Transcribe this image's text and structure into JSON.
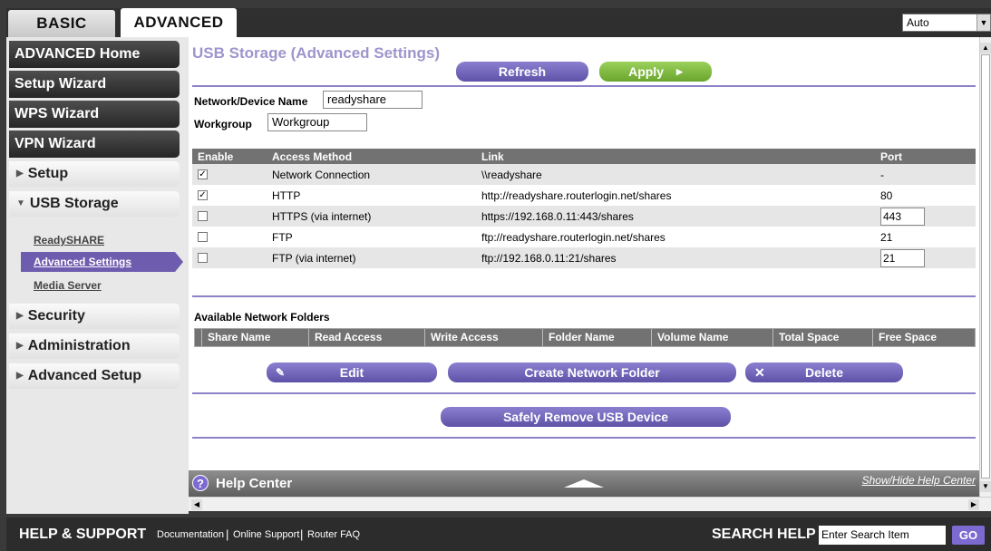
{
  "tabs": {
    "basic": "BASIC",
    "advanced": "ADVANCED"
  },
  "language": {
    "selected": "Auto"
  },
  "nav": {
    "advanced_home": "ADVANCED Home",
    "setup_wizard": "Setup Wizard",
    "wps_wizard": "WPS Wizard",
    "vpn_wizard": "VPN Wizard",
    "setup": "Setup",
    "usb_storage": "USB Storage",
    "usb_sub": {
      "readyshare": "ReadySHARE",
      "advanced_settings": "Advanced Settings",
      "media_server": "Media Server"
    },
    "security": "Security",
    "administration": "Administration",
    "advanced_setup": "Advanced Setup"
  },
  "page": {
    "title": "USB Storage (Advanced Settings)",
    "refresh": "Refresh",
    "apply": "Apply",
    "device_name_label": "Network/Device Name",
    "device_name_value": "readyshare",
    "workgroup_label": "Workgroup",
    "workgroup_value": "Workgroup"
  },
  "access_table": {
    "headers": {
      "enable": "Enable",
      "method": "Access Method",
      "link": "Link",
      "port": "Port"
    },
    "rows": [
      {
        "checked": true,
        "method": "Network Connection",
        "link": "\\\\readyshare",
        "port": "-",
        "port_editable": false
      },
      {
        "checked": true,
        "method": "HTTP",
        "link": "http://readyshare.routerlogin.net/shares",
        "port": "80",
        "port_editable": false
      },
      {
        "checked": false,
        "method": "HTTPS (via internet)",
        "link": "https://192.168.0.11:443/shares",
        "port": "443",
        "port_editable": true
      },
      {
        "checked": false,
        "method": "FTP",
        "link": "ftp://readyshare.routerlogin.net/shares",
        "port": "21",
        "port_editable": false
      },
      {
        "checked": false,
        "method": "FTP (via internet)",
        "link": "ftp://192.168.0.11:21/shares",
        "port": "21",
        "port_editable": true
      }
    ]
  },
  "folders": {
    "label": "Available Network Folders",
    "headers": [
      "Share Name",
      "Read Access",
      "Write Access",
      "Folder Name",
      "Volume Name",
      "Total Space",
      "Free Space"
    ],
    "edit": "Edit",
    "create": "Create Network Folder",
    "delete": "Delete",
    "safely_remove": "Safely Remove USB Device"
  },
  "help": {
    "title": "Help Center",
    "toggle": "Show/Hide Help Center",
    "icon": "?"
  },
  "footer": {
    "title": "HELP & SUPPORT",
    "links": [
      "Documentation",
      "Online Support",
      "Router FAQ"
    ],
    "search_label": "SEARCH HELP",
    "search_placeholder": "Enter Search Item",
    "go": "GO"
  }
}
